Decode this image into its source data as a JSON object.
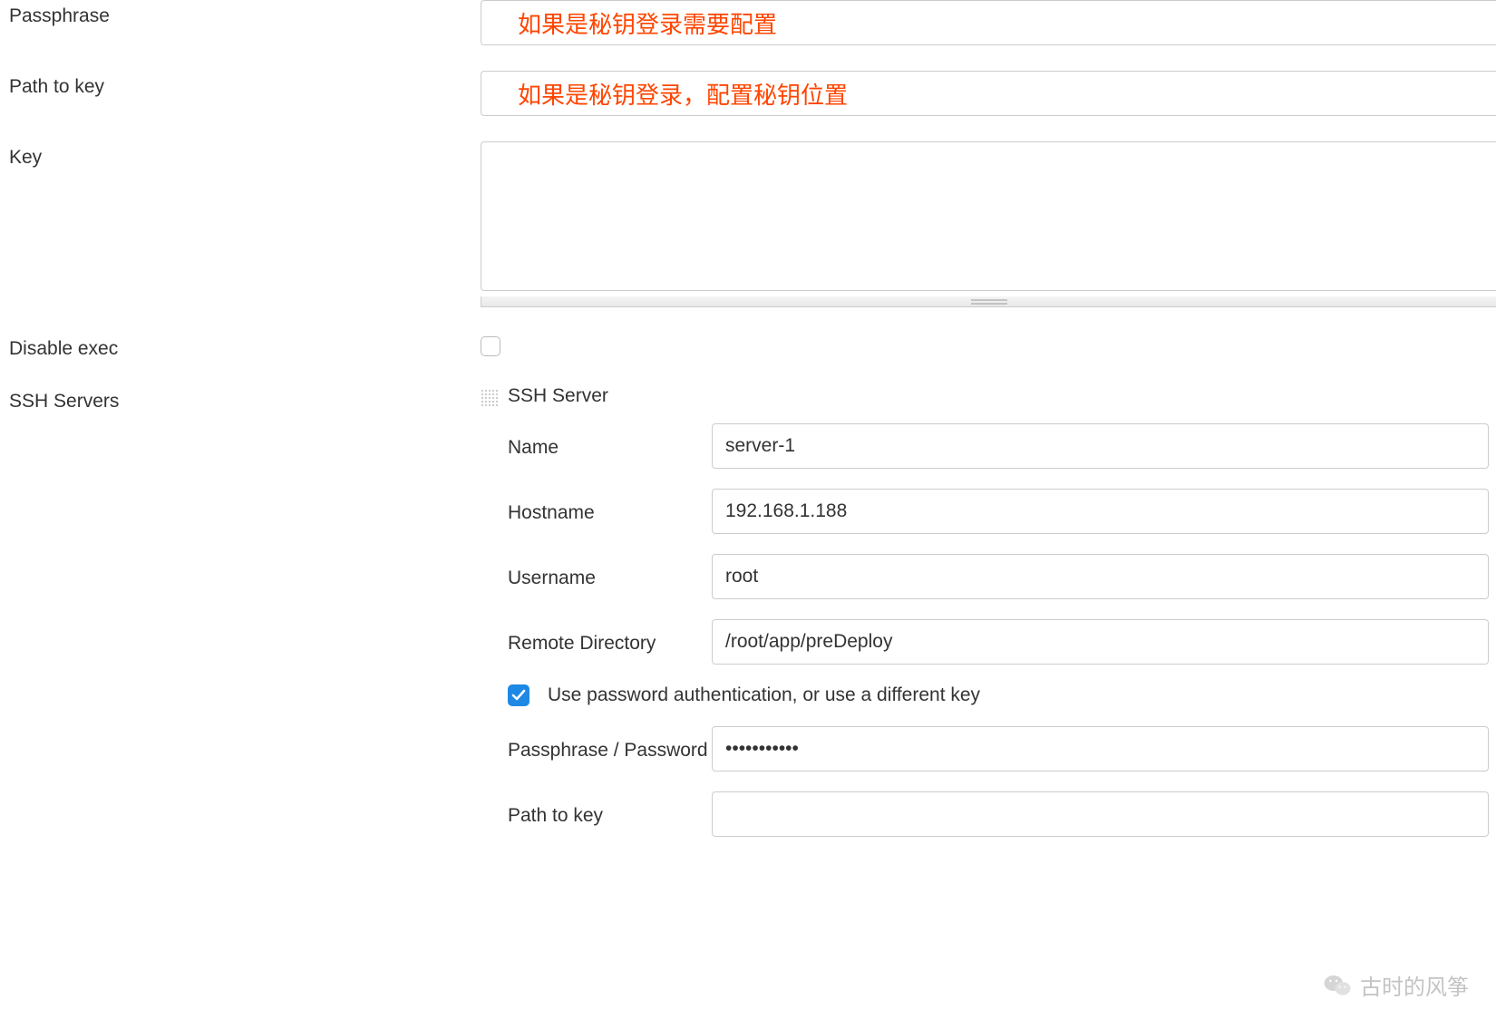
{
  "form": {
    "passphrase": {
      "label": "Passphrase",
      "annotation": "如果是秘钥登录需要配置"
    },
    "path_to_key": {
      "label": "Path to key",
      "annotation": "如果是秘钥登录，配置秘钥位置"
    },
    "key": {
      "label": "Key",
      "value": ""
    },
    "disable_exec": {
      "label": "Disable exec",
      "checked": false
    },
    "ssh_servers": {
      "label": "SSH Servers",
      "section_title": "SSH Server",
      "server": {
        "name": {
          "label": "Name",
          "value": "server-1"
        },
        "hostname": {
          "label": "Hostname",
          "value": "192.168.1.188"
        },
        "username": {
          "label": "Username",
          "value": "root"
        },
        "remote_directory": {
          "label": "Remote Directory",
          "value": "/root/app/preDeploy"
        },
        "use_password_auth": {
          "label": "Use password authentication, or use a different key",
          "checked": true
        },
        "passphrase_password": {
          "label": "Passphrase / Password",
          "value": "•••••••••••"
        },
        "path_to_key": {
          "label": "Path to key",
          "value": ""
        }
      }
    }
  },
  "watermark": {
    "text": "古时的风筝"
  }
}
